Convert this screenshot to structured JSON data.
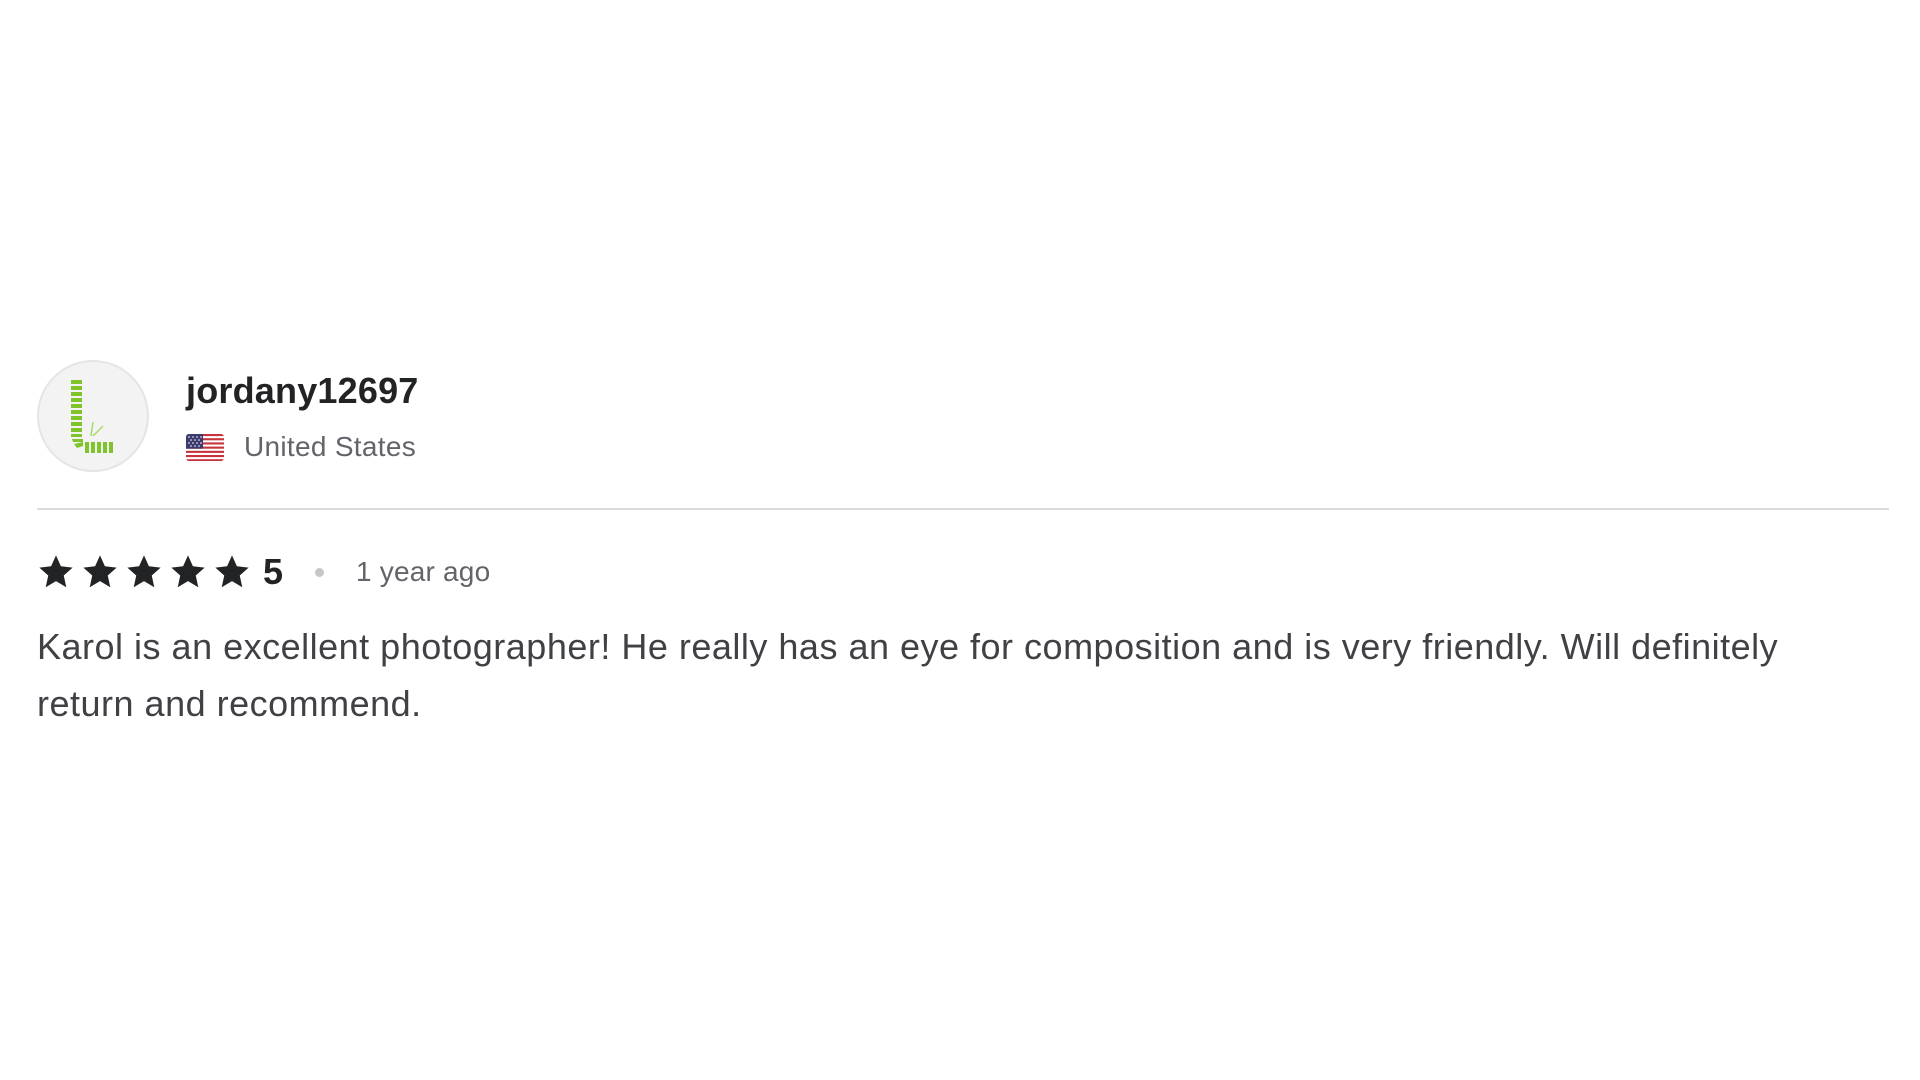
{
  "review": {
    "username": "jordany12697",
    "country": "United States",
    "country_flag_icon": "us-flag-icon",
    "avatar_icon": "letter-l-avatar-icon",
    "avatar_color": "#7fc42a",
    "rating": "5",
    "rating_stars": 5,
    "star_color": "#222325",
    "time_ago": "1 year ago",
    "text": "Karol is an excellent photographer! He really has an eye for composition and is very friendly. Will definitely return and recommend."
  }
}
